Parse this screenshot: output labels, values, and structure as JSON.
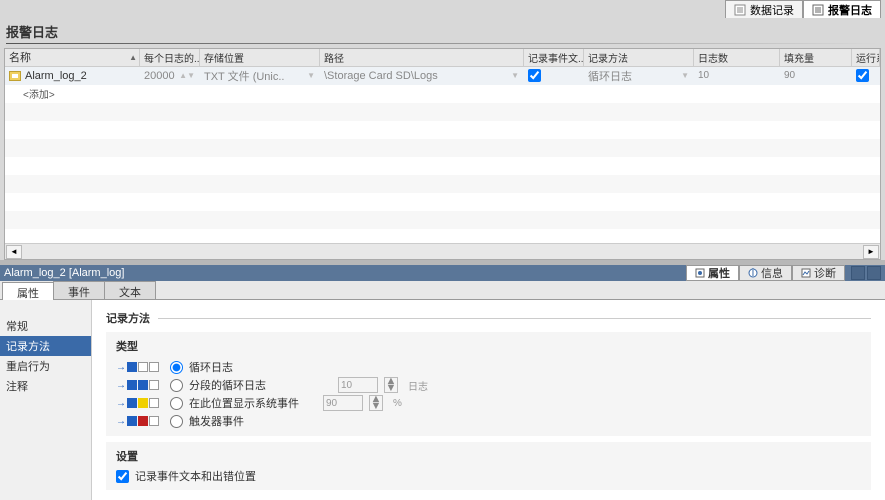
{
  "top_tabs": {
    "data_log": "数据记录",
    "alarm_log": "报警日志"
  },
  "section_title": "报警日志",
  "grid": {
    "headers": {
      "name": "名称",
      "per_log": "每个日志的..",
      "storage": "存储位置",
      "path": "路径",
      "event_text": "记录事件文..",
      "method": "记录方法",
      "log_count": "日志数",
      "fill": "填充量",
      "enable_on_start": "运行系统启动时启用记录"
    },
    "row": {
      "name": "Alarm_log_2",
      "per_log": "20000",
      "storage": "TXT 文件 (Unic..",
      "path": "\\Storage Card SD\\Logs",
      "method": "循环日志",
      "log_count": "10",
      "fill": "90"
    },
    "add_row": "<添加>"
  },
  "obj_header": {
    "title": "Alarm_log_2 [Alarm_log]"
  },
  "obj_tabs": {
    "props": "属性",
    "info": "信息",
    "diag": "诊断"
  },
  "sub_tabs": {
    "props": "属性",
    "events": "事件",
    "text": "文本"
  },
  "nav": {
    "general": "常规",
    "log_method": "记录方法",
    "restart": "重启行为",
    "comment": "注释"
  },
  "detail": {
    "panel_title": "记录方法",
    "group_type": "类型",
    "r1": "循环日志",
    "r2": "分段的循环日志",
    "r3": "在此位置显示系统事件",
    "r4": "触发器事件",
    "r2_val": "10",
    "r2_unit": "日志",
    "r3_val": "90",
    "r3_unit": "%",
    "group_settings": "设置",
    "chk_text": "记录事件文本和出错位置"
  }
}
